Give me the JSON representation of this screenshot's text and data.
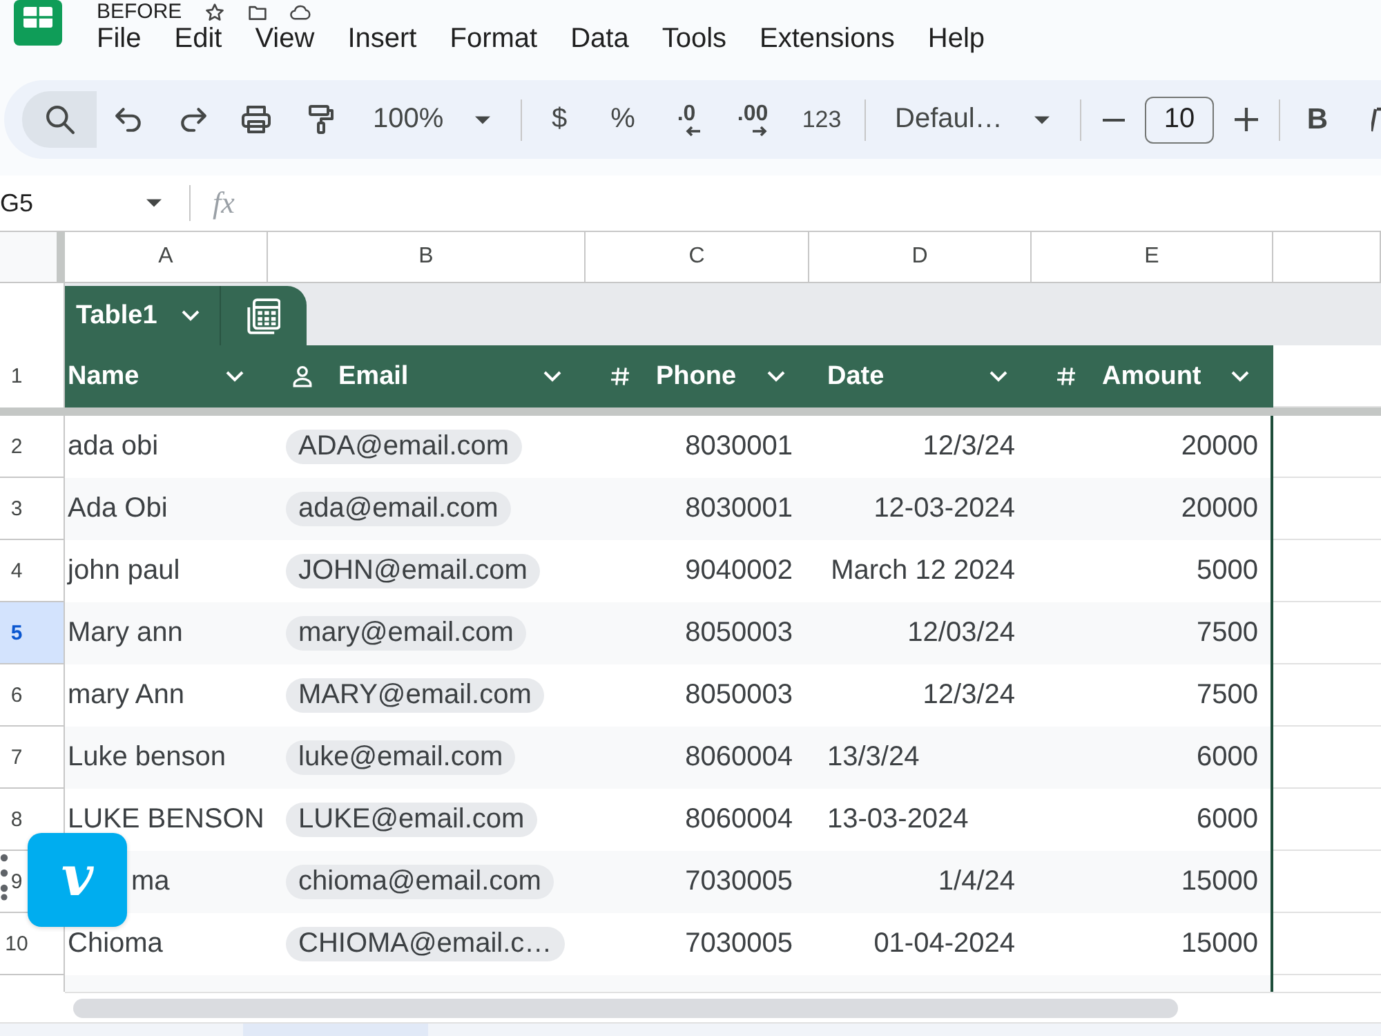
{
  "document": {
    "title": "BEFORE"
  },
  "menu": [
    "File",
    "Edit",
    "View",
    "Insert",
    "Format",
    "Data",
    "Tools",
    "Extensions",
    "Help"
  ],
  "toolbar": {
    "search_active": true,
    "zoom": "100%",
    "currency": "$",
    "percent": "%",
    "decrease_decimal": ".0",
    "increase_decimal": ".00",
    "number_format": "123",
    "font": "Defaul…",
    "font_size": "10",
    "bold": "B"
  },
  "formula_bar": {
    "cell": "G5",
    "fx": "fx"
  },
  "columns": [
    "A",
    "B",
    "C",
    "D",
    "E"
  ],
  "table": {
    "name": "Table1",
    "header_row": "1",
    "headers": [
      {
        "label": "Name",
        "kind": "text"
      },
      {
        "label": "Email",
        "kind": "person"
      },
      {
        "label": "Phone",
        "kind": "number"
      },
      {
        "label": "Date",
        "kind": "date"
      },
      {
        "label": "Amount",
        "kind": "number"
      }
    ],
    "rows": [
      {
        "number": "2",
        "selected": false,
        "name": "ada obi",
        "name_covered": false,
        "email": "ADA@email.com",
        "phone": "8030001",
        "date": "12/3/24",
        "date_as_text": false,
        "amount": "20000"
      },
      {
        "number": "3",
        "selected": false,
        "name": "Ada Obi",
        "name_covered": false,
        "email": "ada@email.com",
        "phone": "8030001",
        "date": "12-03-2024",
        "date_as_text": false,
        "amount": "20000"
      },
      {
        "number": "4",
        "selected": false,
        "name": "john paul",
        "name_covered": false,
        "email": "JOHN@email.com",
        "phone": "9040002",
        "date": "March 12 2024",
        "date_as_text": false,
        "amount": "5000"
      },
      {
        "number": "5",
        "selected": true,
        "name": "Mary ann",
        "name_covered": false,
        "email": "mary@email.com",
        "phone": "8050003",
        "date": "12/03/24",
        "date_as_text": false,
        "amount": "7500"
      },
      {
        "number": "6",
        "selected": false,
        "name": "mary Ann",
        "name_covered": false,
        "email": "MARY@email.com",
        "phone": "8050003",
        "date": "12/3/24",
        "date_as_text": false,
        "amount": "7500"
      },
      {
        "number": "7",
        "selected": false,
        "name": "Luke benson",
        "name_covered": false,
        "email": "luke@email.com",
        "phone": "8060004",
        "date": "13/3/24",
        "date_as_text": true,
        "amount": "6000"
      },
      {
        "number": "8",
        "selected": false,
        "name": "LUKE BENSON",
        "name_covered": false,
        "email": "LUKE@email.com",
        "phone": "8060004",
        "date": "13-03-2024",
        "date_as_text": true,
        "amount": "6000"
      },
      {
        "number": "9",
        "selected": false,
        "name": "ma",
        "name_covered": true,
        "email": "chioma@email.com",
        "phone": "7030005",
        "date": "1/4/24",
        "date_as_text": false,
        "amount": "15000"
      },
      {
        "number": "10",
        "selected": false,
        "name": "Chioma",
        "name_covered": false,
        "email": "CHIOMA@email.c…",
        "phone": "7030005",
        "date": "01-04-2024",
        "date_as_text": false,
        "amount": "15000"
      }
    ]
  },
  "floating_button": {
    "label": "v"
  }
}
